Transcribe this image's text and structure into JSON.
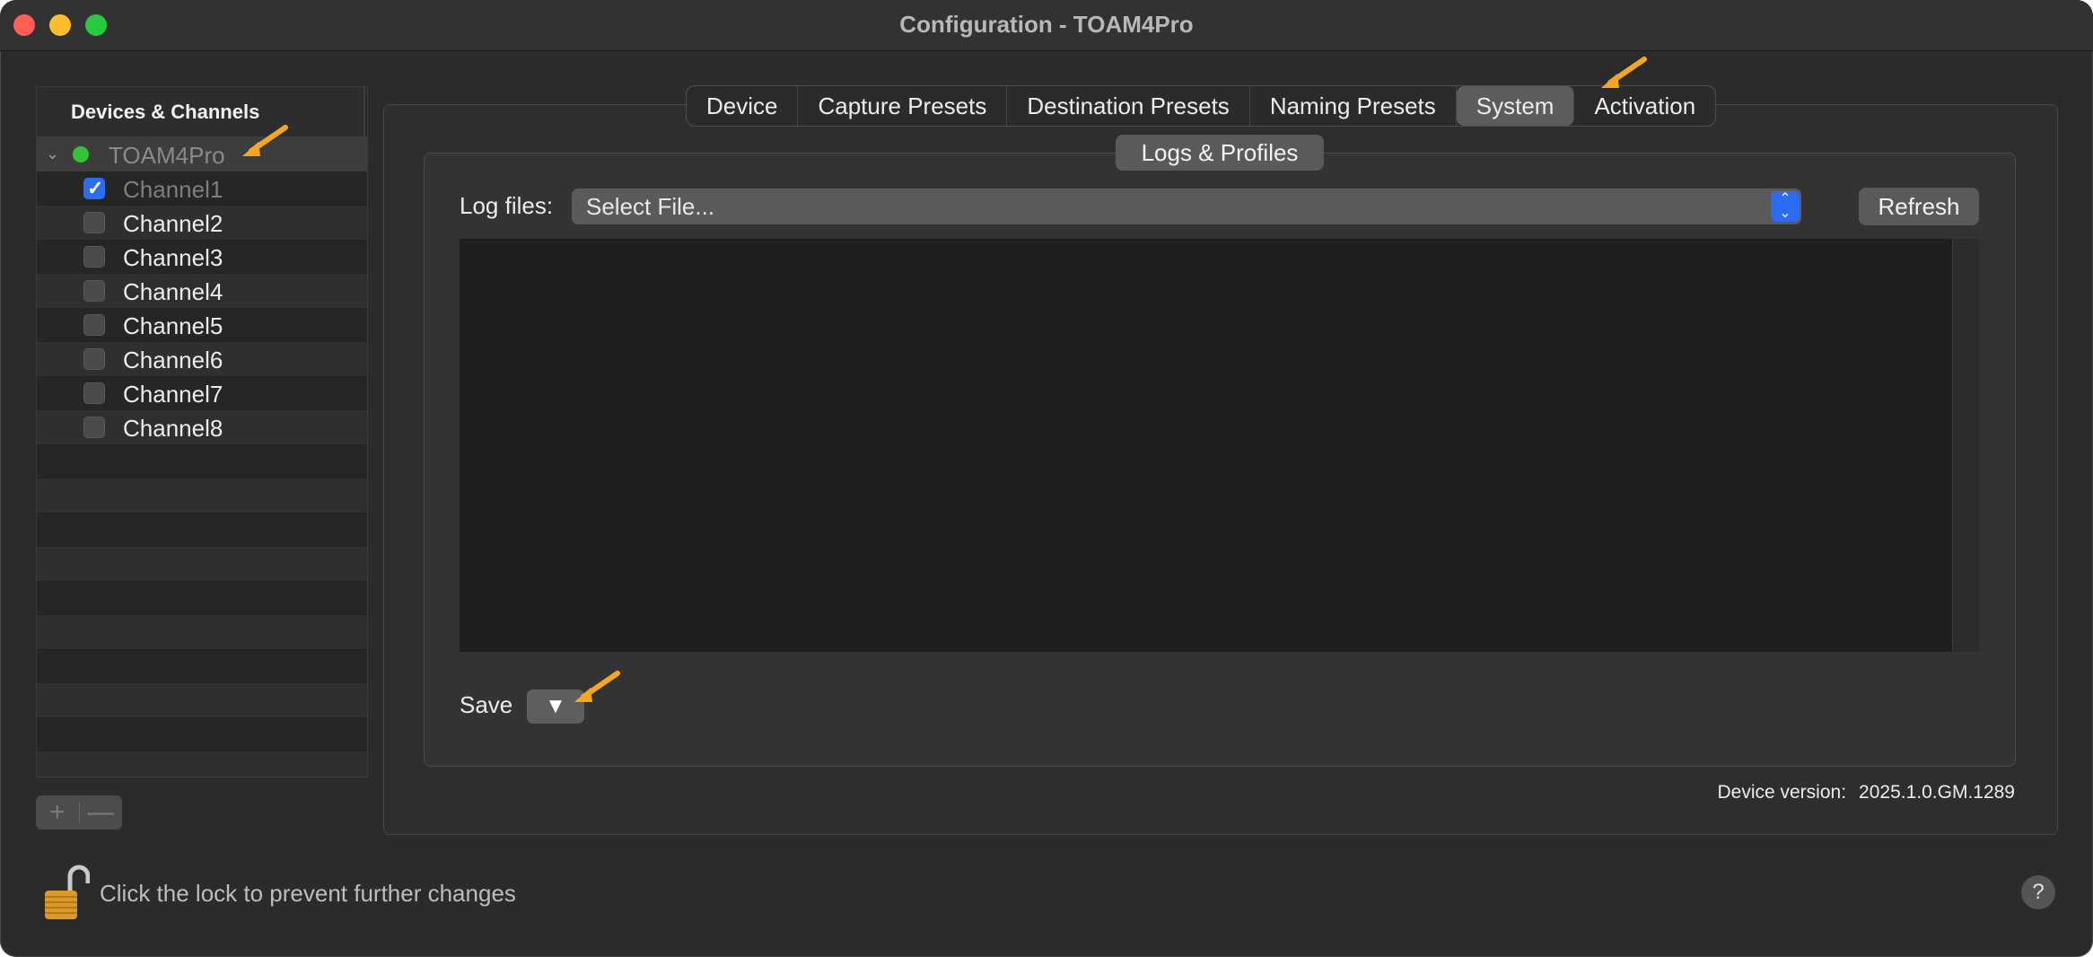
{
  "window": {
    "title": "Configuration - TOAM4Pro"
  },
  "sidebar": {
    "header": "Devices & Channels",
    "device": {
      "name": "TOAM4Pro",
      "status_color": "#33c233"
    },
    "channels": [
      {
        "label": "Channel1",
        "checked": true
      },
      {
        "label": "Channel2",
        "checked": false
      },
      {
        "label": "Channel3",
        "checked": false
      },
      {
        "label": "Channel4",
        "checked": false
      },
      {
        "label": "Channel5",
        "checked": false
      },
      {
        "label": "Channel6",
        "checked": false
      },
      {
        "label": "Channel7",
        "checked": false
      },
      {
        "label": "Channel8",
        "checked": false
      }
    ],
    "add_label": "+",
    "remove_label": "—"
  },
  "tabs": [
    {
      "label": "Device"
    },
    {
      "label": "Capture Presets"
    },
    {
      "label": "Destination Presets"
    },
    {
      "label": "Naming Presets"
    },
    {
      "label": "System",
      "active": true
    },
    {
      "label": "Activation"
    }
  ],
  "system": {
    "group_title": "Logs & Profiles",
    "log_files_label": "Log files:",
    "log_select_value": "Select File...",
    "refresh_label": "Refresh",
    "save_label": "Save",
    "save_button_glyph": "▼",
    "version_label": "Device version:",
    "version_value": "2025.1.0.GM.1289"
  },
  "footer": {
    "lock_text": "Click the lock to prevent further changes",
    "help_label": "?"
  },
  "colors": {
    "accent_blue": "#2b6cf0",
    "annotation_arrow": "#f5a623"
  }
}
